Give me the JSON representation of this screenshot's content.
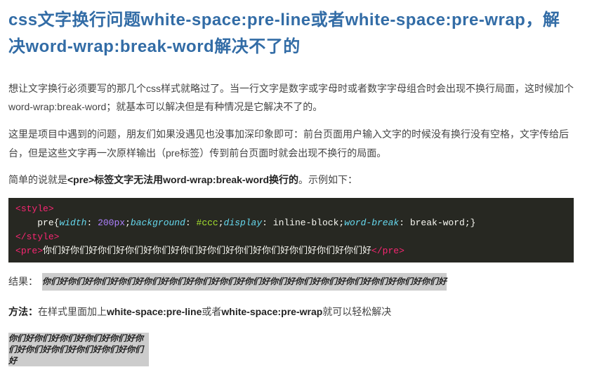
{
  "title": "css文字换行问题white-space:pre-line或者white-space:pre-wrap，解决word-wrap:break-word解决不了的",
  "para1": "想让文字换行必须要写的那几个css样式就略过了。当一行文字是数字或字母时或者数字字母组合时会出现不换行局面，这时候加个word-wrap:break-word；就基本可以解决但是有种情况是它解决不了的。",
  "para2": "这里是项目中遇到的问题，朋友们如果没遇见也没事加深印象即可：前台页面用户输入文字的时候没有换行没有空格，文字传给后台，但是这些文字再一次原样输出（pre标签）传到前台页面时就会出现不换行的局面。",
  "para3_pre": "简单的说就是",
  "para3_bold": "<pre>标签文字无法用word-wrap:break-word换行的",
  "para3_post": "。示例如下：",
  "code": {
    "style_open": "style",
    "selector": "pre",
    "p1": "width",
    "v1": "200px",
    "p2": "background",
    "v2": "#ccc",
    "p3": "display",
    "v3": "inline-block",
    "p4": "word-break",
    "v4": "break-word",
    "style_close": "style",
    "pre_open": "pre",
    "pre_text": "你们好你们好你们好你们好你们好你们好你们好你们好你们好你们好你们好你们好",
    "pre_close": "pre"
  },
  "result_label": "结果：",
  "result_text": "你们好你们好你们好你们好你们好你们好你们好你们好你们好你们好你们好你们好你们好你们好你们好你们好",
  "method_bold1": "方法：",
  "method_text1": "在样式里面加上",
  "method_bold2": "white-space:pre-line",
  "method_text2": "或者",
  "method_bold3": "white-space:pre-wrap",
  "method_text3": "就可以轻松解决",
  "wrapped_text": "你们好你们好你们好你们好你们好你们好你们好你们好你们好你们好你们好"
}
